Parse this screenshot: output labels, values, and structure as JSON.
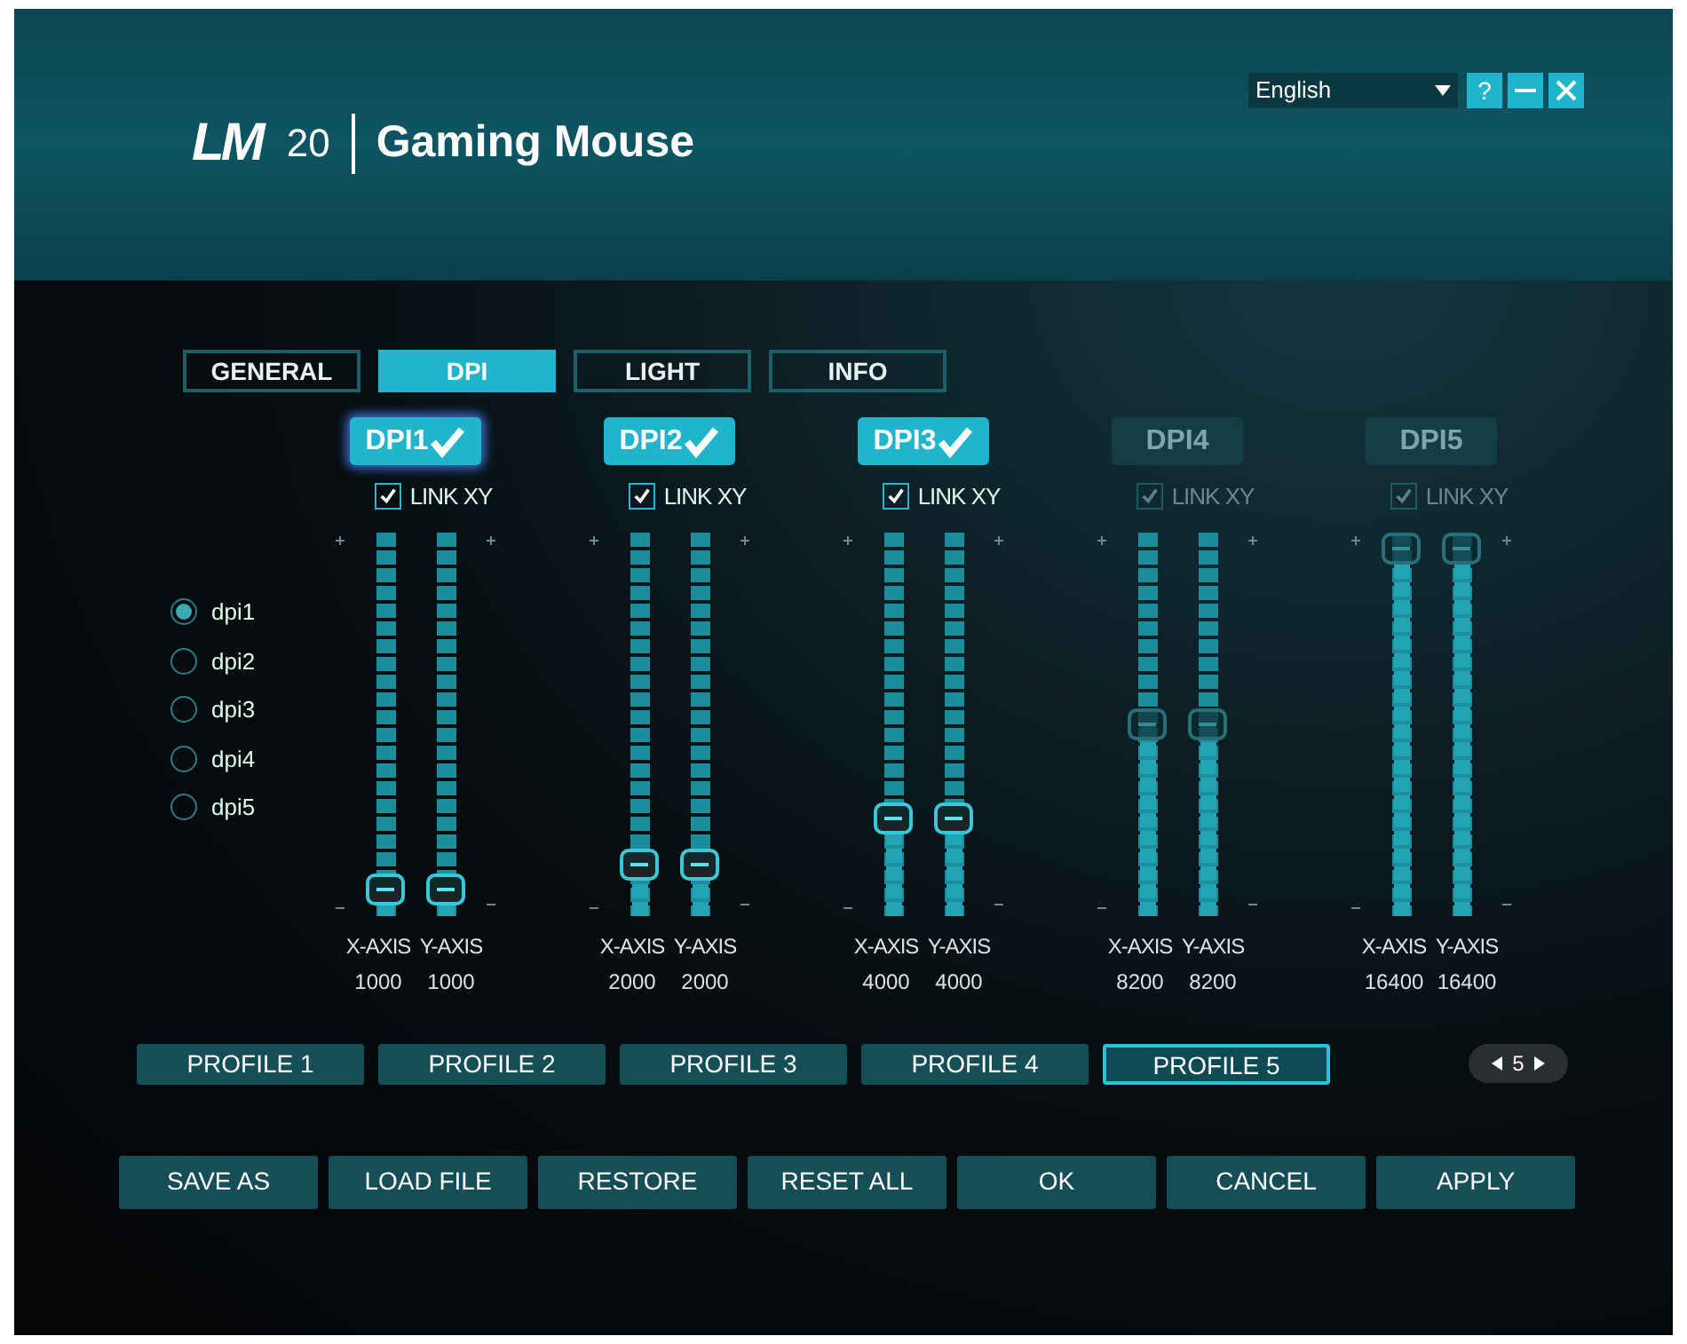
{
  "header": {
    "logo": "LM",
    "model": "20",
    "title": "Gaming Mouse",
    "language": "English",
    "help": "?"
  },
  "tabs": [
    {
      "label": "GENERAL",
      "selected": false
    },
    {
      "label": "DPI",
      "selected": true
    },
    {
      "label": "LIGHT",
      "selected": false
    },
    {
      "label": "INFO",
      "selected": false
    }
  ],
  "dpi_options": [
    {
      "label": "dpi1",
      "selected": true
    },
    {
      "label": "dpi2",
      "selected": false
    },
    {
      "label": "dpi3",
      "selected": false
    },
    {
      "label": "dpi4",
      "selected": false
    },
    {
      "label": "dpi5",
      "selected": false
    }
  ],
  "dpi_levels": [
    {
      "label": "DPI1",
      "enabled": true,
      "selected": true,
      "link_label": "LINK XY",
      "link_checked": true,
      "x_axis": {
        "label": "X-AXIS",
        "value": "1000",
        "level": 0.03
      },
      "y_axis": {
        "label": "Y-AXIS",
        "value": "1000",
        "level": 0.03
      }
    },
    {
      "label": "DPI2",
      "enabled": true,
      "selected": false,
      "link_label": "LINK XY",
      "link_checked": true,
      "x_axis": {
        "label": "X-AXIS",
        "value": "2000",
        "level": 0.1
      },
      "y_axis": {
        "label": "Y-AXIS",
        "value": "2000",
        "level": 0.1
      }
    },
    {
      "label": "DPI3",
      "enabled": true,
      "selected": false,
      "link_label": "LINK XY",
      "link_checked": true,
      "x_axis": {
        "label": "X-AXIS",
        "value": "4000",
        "level": 0.23
      },
      "y_axis": {
        "label": "Y-AXIS",
        "value": "4000",
        "level": 0.23
      }
    },
    {
      "label": "DPI4",
      "enabled": false,
      "selected": false,
      "link_label": "LINK XY",
      "link_checked": true,
      "x_axis": {
        "label": "X-AXIS",
        "value": "8200",
        "level": 0.5
      },
      "y_axis": {
        "label": "Y-AXIS",
        "value": "8200",
        "level": 0.5
      }
    },
    {
      "label": "DPI5",
      "enabled": false,
      "selected": false,
      "link_label": "LINK XY",
      "link_checked": true,
      "x_axis": {
        "label": "X-AXIS",
        "value": "16400",
        "level": 1
      },
      "y_axis": {
        "label": "Y-AXIS",
        "value": "16400",
        "level": 1
      }
    }
  ],
  "profiles": [
    {
      "label": "PROFILE 1",
      "selected": false
    },
    {
      "label": "PROFILE 2",
      "selected": false
    },
    {
      "label": "PROFILE 3",
      "selected": false
    },
    {
      "label": "PROFILE 4",
      "selected": false
    },
    {
      "label": "PROFILE 5",
      "selected": true
    }
  ],
  "profile_pager": "5",
  "buttons": [
    "SAVE AS",
    "LOAD FILE",
    "RESTORE",
    "RESET ALL",
    "OK",
    "CANCEL",
    "APPLY"
  ]
}
